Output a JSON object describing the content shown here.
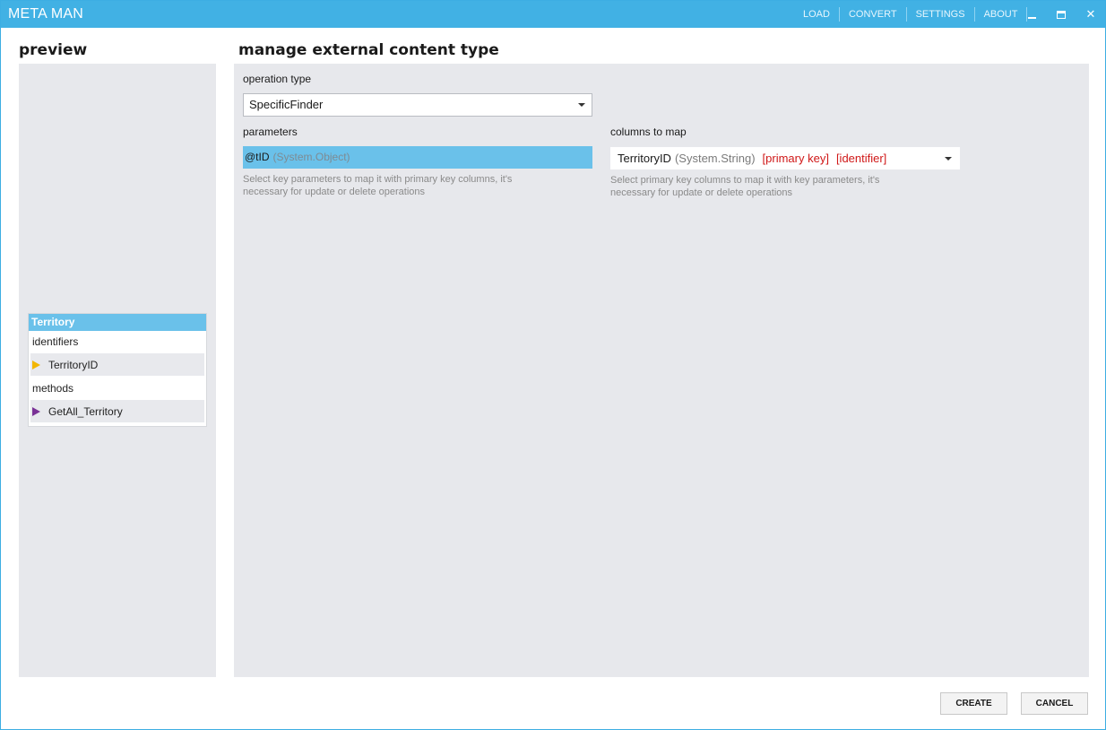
{
  "app": {
    "title": "META MAN",
    "menu": {
      "load": "LOAD",
      "convert": "CONVERT",
      "settings": "SETTINGS",
      "about": "ABOUT"
    },
    "window_controls": {
      "close_glyph": "✕"
    }
  },
  "preview": {
    "heading": "preview",
    "entity": {
      "name": "Territory",
      "identifiers_label": "identifiers",
      "identifiers": [
        "TerritoryID"
      ],
      "methods_label": "methods",
      "methods": [
        "GetAll_Territory"
      ]
    }
  },
  "manage": {
    "heading": "manage external content type",
    "operation_type": {
      "label": "operation type",
      "selected": "SpecificFinder"
    },
    "parameters": {
      "label": "parameters",
      "selected_name": "@tID",
      "selected_type": "(System.Object)",
      "hint_line1": "Select key parameters to map it with primary key columns, it's",
      "hint_line2": "necessary for update or delete operations"
    },
    "columns": {
      "label": "columns to map",
      "selected_name": "TerritoryID",
      "selected_type": "(System.String)",
      "tag_primary": "[primary key]",
      "tag_identifier": "[identifier]",
      "hint_line1": "Select primary key columns to map it with key parameters, it's",
      "hint_line2": "necessary for update or delete operations"
    }
  },
  "footer": {
    "create_label": "CREATE",
    "cancel_label": "CANCEL"
  },
  "colors": {
    "titlebar": "#41b1e4",
    "selection": "#6ac1ea",
    "panel_bg": "#e7e8ec",
    "tag_red": "#d01818",
    "identifier_marker": "#f2b600",
    "method_marker": "#7a3296"
  },
  "icons": {
    "identifier_marker": "yellow-triangle-icon",
    "method_marker": "purple-triangle-icon",
    "dropdown": "caret-down-icon",
    "minimize": "minimize-icon",
    "maximize": "maximize-icon",
    "close": "close-icon"
  }
}
